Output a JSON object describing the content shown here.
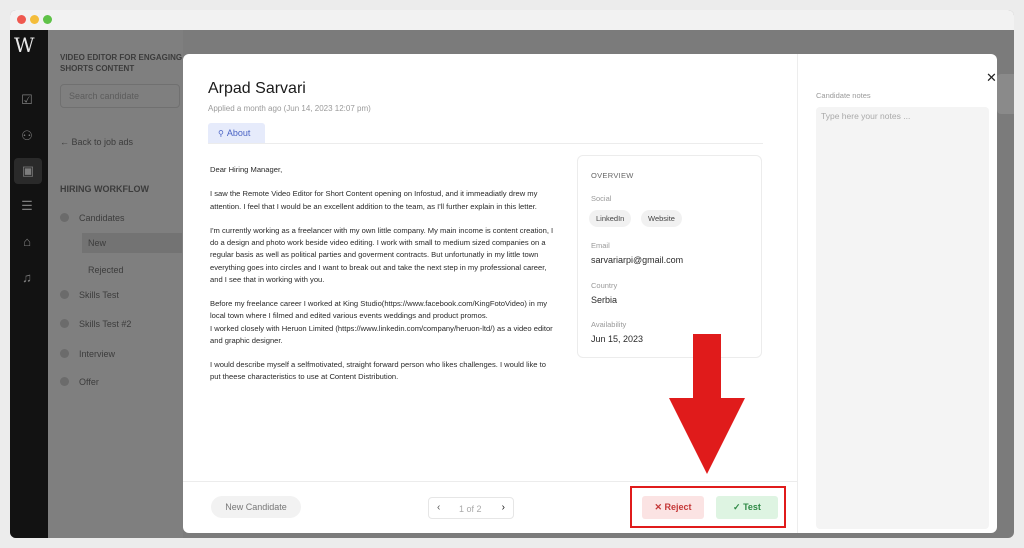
{
  "window": {
    "logo": "W"
  },
  "background": {
    "job_title": "VIDEO EDITOR FOR ENGAGING SHORTS CONTENT",
    "search_placeholder": "Search candidate",
    "back_link": "← Back to job ads",
    "workflow_title": "HIRING WORKFLOW",
    "steps": [
      "Candidates",
      "Skills Test",
      "Skills Test #2",
      "Interview",
      "Offer"
    ],
    "substeps": [
      "New",
      "Rejected"
    ]
  },
  "candidate": {
    "name": "Arpad Sarvari",
    "applied": "Applied a month ago (Jun 14, 2023 12:07 pm)",
    "tab": "About"
  },
  "letter": [
    "Dear Hiring Manager,",
    "I saw the Remote Video Editor for Short Content opening on Infostud, and it immeadiatly drew my attention. I feel that I would be an excellent addition to the team, as I'll further explain in this letter.",
    "I'm currently working as a freelancer with my own little company. My main income is content creation, I do a design and photo work beside video editing. I work with small to medium sized companies on a regular basis as well as political parties and goverment contracts. But unfortunatly in my little town everything goes into circles and I want to break out and take the next step in my professional career, and I see that in working with you.",
    "Before my freelance career I worked at King Studio(https://www.facebook.com/KingFotoVideo) in my local town where I filmed and edited various events weddings and product promos.\nI worked closely with Heruon Limited (https://www.linkedin.com/company/heruon-ltd/) as a video editor and graphic designer.",
    "I would describe myself a selfmotivated, straight forward person who likes challenges. I would like to put theese characteristics to use at Content Distribution."
  ],
  "overview": {
    "heading": "OVERVIEW",
    "social_label": "Social",
    "social_links": [
      "LinkedIn",
      "Website"
    ],
    "email_label": "Email",
    "email": "sarvariarpi@gmail.com",
    "country_label": "Country",
    "country": "Serbia",
    "availability_label": "Availability",
    "availability": "Jun 15, 2023"
  },
  "notes": {
    "label": "Candidate notes",
    "placeholder": "Type here your notes ..."
  },
  "footer": {
    "stage_button": "New Candidate",
    "pager": "1 of 2",
    "reject": "Reject",
    "test": "Test"
  },
  "colors": {
    "reject_bg": "#fbe3e3",
    "reject_fg": "#c53737",
    "test_bg": "#def4e2",
    "test_fg": "#2f8a46",
    "highlight": "#e01b1b",
    "tab_accent": "#4a63c4"
  }
}
